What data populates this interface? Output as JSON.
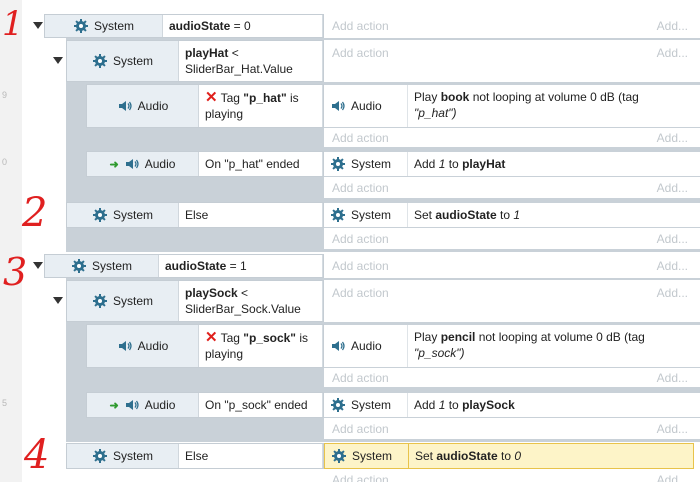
{
  "labels": {
    "system": "System",
    "audio": "Audio",
    "add_action": "Add action",
    "add_short": "Add..."
  },
  "annotations": [
    "1",
    "2",
    "3",
    "4"
  ],
  "line_numbers": [
    "9",
    "0",
    "5"
  ],
  "blocks": {
    "e1": {
      "var": "audioState",
      "op": " = 0"
    },
    "e2": {
      "var": "playHat",
      "op": " <",
      "line2": "SliderBar_Hat.Value"
    },
    "e3": {
      "cond_pre": "Tag ",
      "cond_tag": "\"p_hat\"",
      "cond_post": " is",
      "cond_line2": "playing",
      "act_pre": "Play ",
      "act_name": "book",
      "act_mid": " not looping at volume 0 dB (tag",
      "act_line2": "\"p_hat\")"
    },
    "e4": {
      "cond": "On \"p_hat\" ended",
      "act_pre": "Add ",
      "act_num": "1",
      "act_mid": " to ",
      "act_var": "playHat"
    },
    "e5": {
      "cond": "Else",
      "act_pre": "Set ",
      "act_var": "audioState",
      "act_mid": " to ",
      "act_num": "1"
    },
    "e6": {
      "var": "audioState",
      "op": " = 1"
    },
    "e7": {
      "var": "playSock",
      "op": " <",
      "line2": "SliderBar_Sock.Value"
    },
    "e8": {
      "cond_pre": "Tag ",
      "cond_tag": "\"p_sock\"",
      "cond_post": " is",
      "cond_line2": "playing",
      "act_pre": "Play ",
      "act_name": "pencil",
      "act_mid": " not looping at volume 0 dB (tag",
      "act_line2": "\"p_sock\")"
    },
    "e9": {
      "cond": "On \"p_sock\" ended",
      "act_pre": "Add ",
      "act_num": "1",
      "act_mid": " to ",
      "act_var": "playSock"
    },
    "e10": {
      "cond": "Else",
      "act_pre": "Set ",
      "act_var": "audioState",
      "act_mid": " to ",
      "act_num": "0"
    }
  },
  "colors": {
    "gear": "#2e6f8e",
    "speaker": "#2e6f8e",
    "cross": "#e0201c",
    "trigger_arrow": "#2f9a2f",
    "highlight": "#fdf4c8",
    "annotation": "#e02020"
  }
}
